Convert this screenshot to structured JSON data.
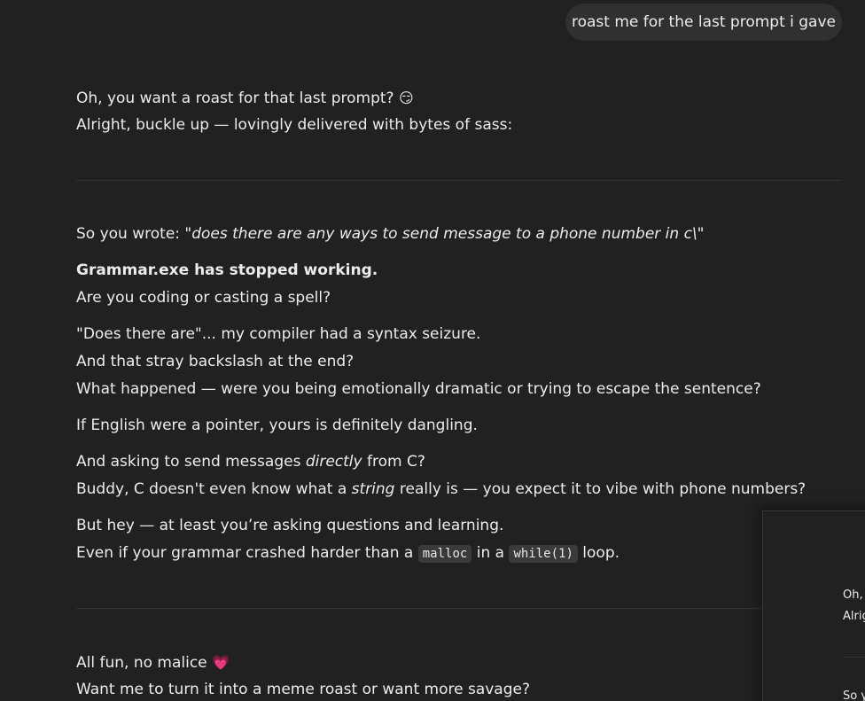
{
  "user_message": "roast me for the last prompt i gave",
  "assistant": {
    "intro": {
      "line1": "Oh, you want a roast for that last prompt?",
      "line1_emoji": "😏",
      "line2": "Alright, buckle up — lovingly delivered with bytes of sass:"
    },
    "quote": {
      "prefix": "So you wrote: \"",
      "text": "does there are any ways to send message to a phone number in c\\",
      "suffix": "\""
    },
    "p1": {
      "bold": "Grammar.exe has stopped working.",
      "line2": "Are you coding or casting a spell?"
    },
    "p2": {
      "line1": "\"Does there are\"... my compiler had a syntax seizure.",
      "line2": "And that stray backslash at the end?",
      "line3": "What happened — were you being emotionally dramatic or trying to escape the sentence?"
    },
    "p3": "If English were a pointer, yours is definitely dangling.",
    "p4": {
      "l1_a": "And asking to send messages ",
      "l1_i": "directly",
      "l1_b": " from C?",
      "l2_a": "Buddy, C doesn't even know what a ",
      "l2_i": "string",
      "l2_b": " really is — you expect it to vibe with phone numbers?"
    },
    "p5": {
      "line1": "But hey — at least you’re asking questions and learning.",
      "l2_a": "Even if your grammar crashed harder than a ",
      "code1": "malloc",
      "l2_b": " in a ",
      "code2": "while(1)",
      "l2_c": " loop."
    },
    "outro": {
      "line1": "All fun, no malice",
      "line1_emoji": "💗",
      "line2": "Want me to turn it into a meme roast or want more savage?"
    }
  },
  "popup_preview": {
    "line1": "Oh,",
    "line2": "Alrig",
    "line3": "So y"
  }
}
